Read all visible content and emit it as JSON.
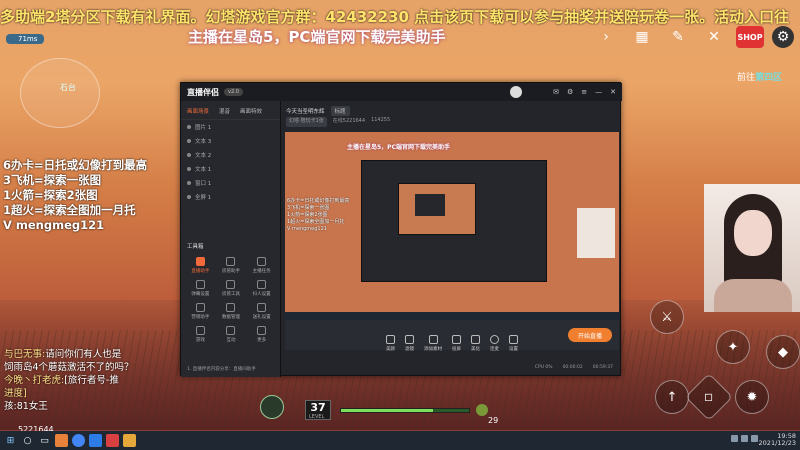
{
  "ticker": "多助端2塔分区下载有礼界面。幻塔游戏官方群：42432230 点击该页下载可以参与抽奖并送陪玩卷一张。活动入口往",
  "subtitle": "主播在星岛5，PC端官网下载完美助手",
  "signal": "71ms",
  "minimap_label": "石台",
  "region": {
    "prefix": "前往",
    "name": "第四区"
  },
  "left_info": "6办卡=日托或幻像打到最高\n3飞机=探索一张图\n1火箭=探索2张图\n1超火=探索全图加一月托\nV mengmeg121",
  "top_icons": [
    "chevron-icon",
    "calendar-icon",
    "edit-icon",
    "tools-icon",
    "shop-icon",
    "gear-icon"
  ],
  "shop_label": "SHOP",
  "new_badge": "NEW",
  "chat": [
    {
      "name": "与巴无事:",
      "text": "请问你们有人也是"
    },
    {
      "name": "",
      "text": "饲雨岛4个蘑菇激活不了的吗？"
    },
    {
      "name": "今晚丶打老虎:",
      "text": "[旅行者号-推"
    },
    {
      "name": "进度]",
      "text": ""
    },
    {
      "name": "",
      "text": "孩:81女王"
    }
  ],
  "uid": "5221644",
  "level": "37",
  "level_label": "LEVEL",
  "hp_percent": 72,
  "hp_number": "29",
  "taskbar": {
    "time": "19:58",
    "date": "2021/12/23"
  },
  "streaming_software": {
    "logo": "直播伴侣",
    "version": "v2.0",
    "tabs": [
      "画面场景",
      "混音",
      "画面特效"
    ],
    "scenes": [
      "图片 1",
      "文本 3",
      "文本 2",
      "文本 1",
      "窗口 1",
      "全屏 1"
    ],
    "tools_title": "工具箱",
    "tools": [
      {
        "label": "直播助手",
        "active": true
      },
      {
        "label": "房管助手",
        "active": false
      },
      {
        "label": "主播任务",
        "active": false
      },
      {
        "label": "弹幕设置",
        "active": false
      },
      {
        "label": "房管工具",
        "active": false
      },
      {
        "label": "抖人设置",
        "active": false
      },
      {
        "label": "营销助手",
        "active": false
      },
      {
        "label": "数据管理",
        "active": false
      },
      {
        "label": "送礼设置",
        "active": false
      },
      {
        "label": "游戏",
        "active": false
      },
      {
        "label": "互动",
        "active": false
      },
      {
        "label": "更多",
        "active": false
      }
    ],
    "bottom_note": "1. 直播伴侣内容分享：直播间助手",
    "info_title": "今天当圣明东辉",
    "info_badge": "标题",
    "info_sub": [
      "幻塔·陪玩卡1张",
      "在线5221644",
      "114255"
    ],
    "controls": [
      "美颜",
      "滤镜",
      "添加素材",
      "投屏",
      "美化",
      "连麦",
      "设置"
    ],
    "live_button": "开始直播",
    "status": [
      "CPU 0%",
      "00:00:02",
      "00:59:37"
    ]
  }
}
